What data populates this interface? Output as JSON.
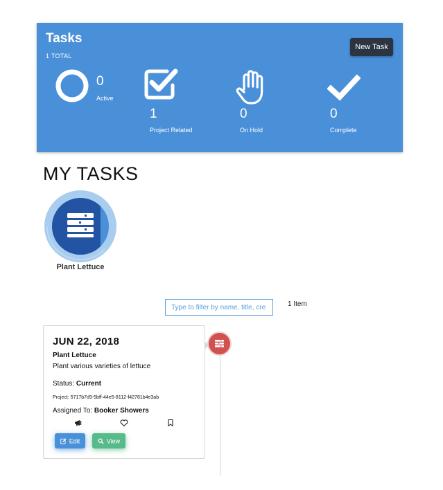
{
  "header": {
    "title": "Tasks",
    "total": "1 TOTAL",
    "new_task_label": "New Task",
    "stats": [
      {
        "value": "0",
        "label": "Active"
      },
      {
        "value": "1",
        "label": "Project Related"
      },
      {
        "value": "0",
        "label": "On Hold"
      },
      {
        "value": "0",
        "label": "Complete"
      }
    ]
  },
  "my_tasks": {
    "heading": "MY TASKS",
    "project": {
      "name": "Plant Lettuce",
      "icon": "tasks-list-icon"
    }
  },
  "filter": {
    "placeholder": "Type to filter by name, title, cre",
    "count": "1 Item"
  },
  "task": {
    "date": "JUN 22, 2018",
    "title": "Plant Lettuce",
    "description": "Plant various varieties of lettuce",
    "status_label": "Status: ",
    "status_value": "Current",
    "project": "Project: 5717b7d9-5bff-44e5-8112-f42781b4e3ab",
    "assigned_label": "Assigned To: ",
    "assigned_value": "Booker Showers",
    "edit_label": "Edit",
    "view_label": "View"
  },
  "colors": {
    "panel": "#4a90d9",
    "new_task_button": "#2b3441",
    "edit_button": "#4a90d9",
    "view_button": "#58b98a",
    "timeline_dot": "#d0514f"
  }
}
